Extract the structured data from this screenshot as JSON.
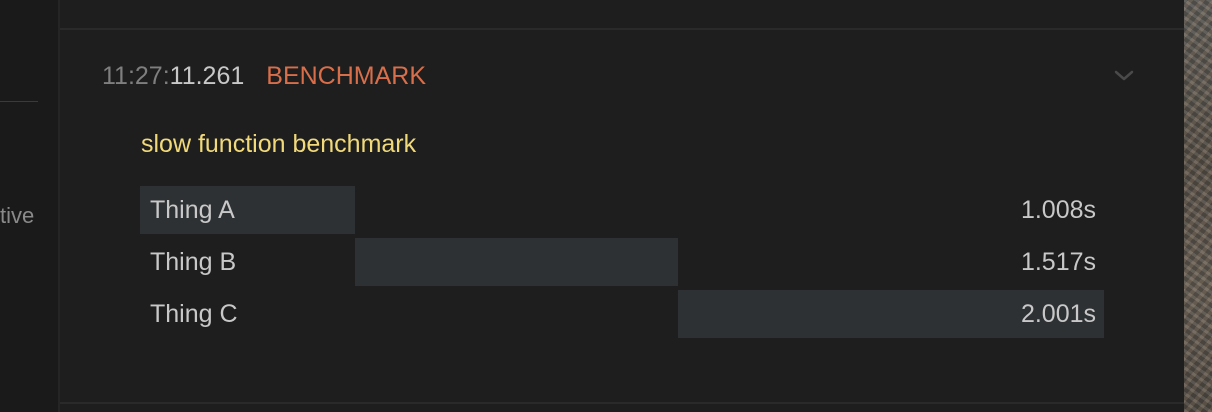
{
  "sidebar": {
    "partial_label": "tive"
  },
  "log_entry": {
    "timestamp_hm": "11:27:",
    "timestamp_rest": "11.261",
    "tag": "BENCHMARK",
    "tag_color": "#d86e4a",
    "icon": "chevron-down-icon"
  },
  "benchmark": {
    "title": "slow function benchmark",
    "title_color": "#f1d97a",
    "rows": [
      {
        "label": "Thing A",
        "value": "1.008s",
        "start_s": 0.0,
        "end_s": 1.008
      },
      {
        "label": "Thing B",
        "value": "1.517s",
        "start_s": 1.008,
        "end_s": 2.525
      },
      {
        "label": "Thing C",
        "value": "2.001s",
        "start_s": 2.525,
        "end_s": 4.526
      }
    ]
  }
}
